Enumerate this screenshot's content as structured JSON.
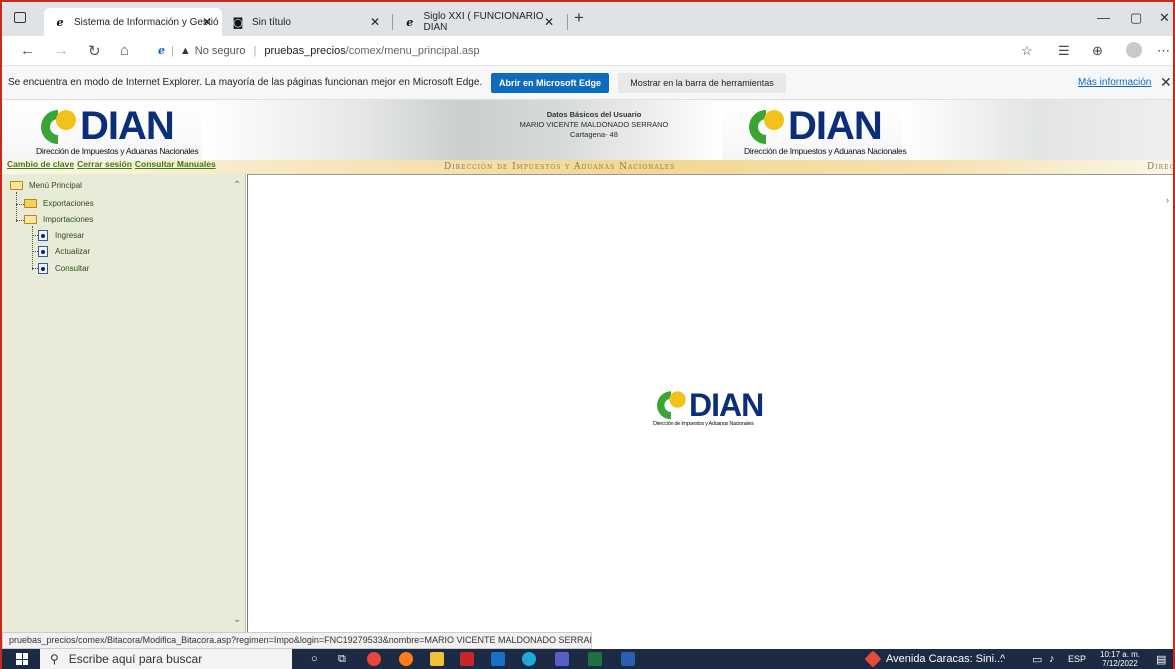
{
  "browser": {
    "tabs": [
      {
        "title": "Sistema de Información y Gestió",
        "active": true
      },
      {
        "title": "Sin título",
        "active": false
      },
      {
        "title": "Siglo XXI ( FUNCIONARIO DIAN",
        "active": false
      }
    ],
    "new_tab": "+",
    "address": {
      "security": "No seguro",
      "host": "pruebas_precios",
      "path": "/comex/menu_principal.asp"
    }
  },
  "ie_bar": {
    "message": "Se encuentra en modo de Internet Explorer. La mayoría de las páginas funcionan mejor en Microsoft Edge.",
    "open_edge": "Abrir en Microsoft Edge",
    "show_toolbar": "Mostrar en la barra de herramientas",
    "more_info": "Más información"
  },
  "banner": {
    "logo_word": "DIAN",
    "logo_sub": "Dirección de Impuestos y Aduanas Nacionales",
    "user_title": "Datos Básicos del Usuario",
    "user_name": "MARIO VICENTE MALDONADO SERRANO",
    "user_city": "Cartagena- 48",
    "stripe_text": "Dirección de Impuestos y Aduanas Nacionales",
    "stripe_text_cut": "Direc",
    "links": [
      "Cambio de clave",
      "Cerrar sesión",
      "Consultar Manuales"
    ]
  },
  "tree": {
    "root": "Menú Principal",
    "items": [
      "Exportaciones",
      "Importaciones",
      "Ingresar",
      "Actualizar",
      "Consultar"
    ]
  },
  "status_url": "pruebas_precios/comex/Bitacora/Modifica_Bitacora.asp?regimen=Impo&login=FNC19279533&nombre=MARIO VICENTE MALDONADO SERRANO",
  "taskbar": {
    "search_placeholder": "Escribe aquí para buscar",
    "weather": "Avenida Caracas: Sini...",
    "lang": "ESP",
    "time": "10:17 a. m.",
    "date": "7/12/2022"
  },
  "colors": {
    "brand_blue": "#0b2e7a",
    "brand_yellow": "#f2c21b",
    "brand_green": "#3aa535",
    "tree_bg": "#e8ebd8",
    "edge_blue": "#0f6cbd"
  }
}
